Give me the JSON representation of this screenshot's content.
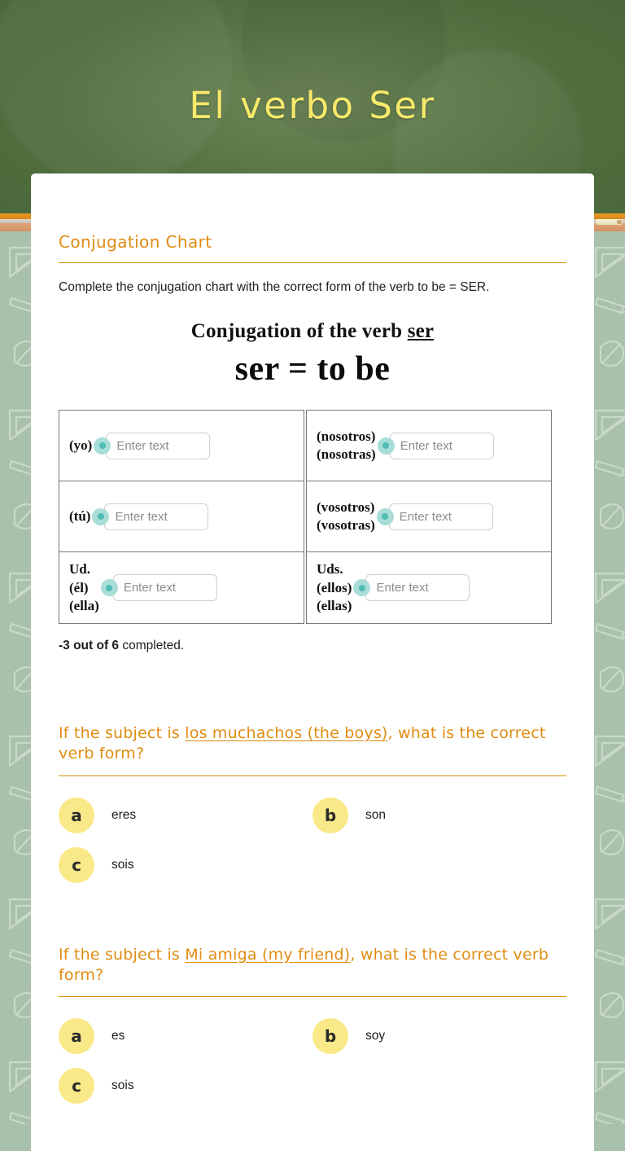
{
  "header": {
    "title": "El verbo Ser",
    "title_color": "#f7e96b",
    "board_color": "#4d6a3c"
  },
  "theme": {
    "accent_orange": "#e08c12",
    "rule_orange": "#d98e04",
    "badge_yellow": "#fae988",
    "marker_teal_outer": "#a9ddd7",
    "marker_teal_inner": "#4fbdb3",
    "page_bg": "#a9c0ab",
    "card_bg": "#ffffff"
  },
  "section": {
    "heading": "Conjugation Chart",
    "instructions": "Complete the conjugation chart with the correct form of the verb to be = SER."
  },
  "conjugation_image": {
    "title_prefix": "Conjugation of the verb ",
    "title_underlined": "ser",
    "subtitle": "ser = to be"
  },
  "conjugation_table": {
    "input_placeholder": "Enter text",
    "left_column": [
      {
        "pronoun_lines": [
          "(yo)"
        ],
        "value": ""
      },
      {
        "pronoun_lines": [
          "(tú)"
        ],
        "value": ""
      },
      {
        "pronoun_lines": [
          "Ud.",
          "(él)",
          "(ella)"
        ],
        "value": ""
      }
    ],
    "right_column": [
      {
        "pronoun_lines": [
          "(nosotros)",
          "(nosotras)"
        ],
        "value": ""
      },
      {
        "pronoun_lines": [
          "(vosotros)",
          "(vosotras)"
        ],
        "value": ""
      },
      {
        "pronoun_lines": [
          "Uds.",
          "(ellos)",
          "(ellas)"
        ],
        "value": ""
      }
    ]
  },
  "completion": {
    "bold_text": "-3 out of 6",
    "rest_text": " completed."
  },
  "questions": [
    {
      "prefix": "If the subject is ",
      "underlined": "los muchachos (the boys)",
      "suffix": ", what is the correct verb form?",
      "options": [
        {
          "key": "a",
          "label": "eres"
        },
        {
          "key": "b",
          "label": "son"
        },
        {
          "key": "c",
          "label": "sois"
        }
      ]
    },
    {
      "prefix": "If the subject is ",
      "underlined": "Mi amiga (my friend)",
      "suffix": ", what is the correct verb form?",
      "options": [
        {
          "key": "a",
          "label": "es"
        },
        {
          "key": "b",
          "label": "soy"
        },
        {
          "key": "c",
          "label": "sois"
        }
      ]
    }
  ]
}
